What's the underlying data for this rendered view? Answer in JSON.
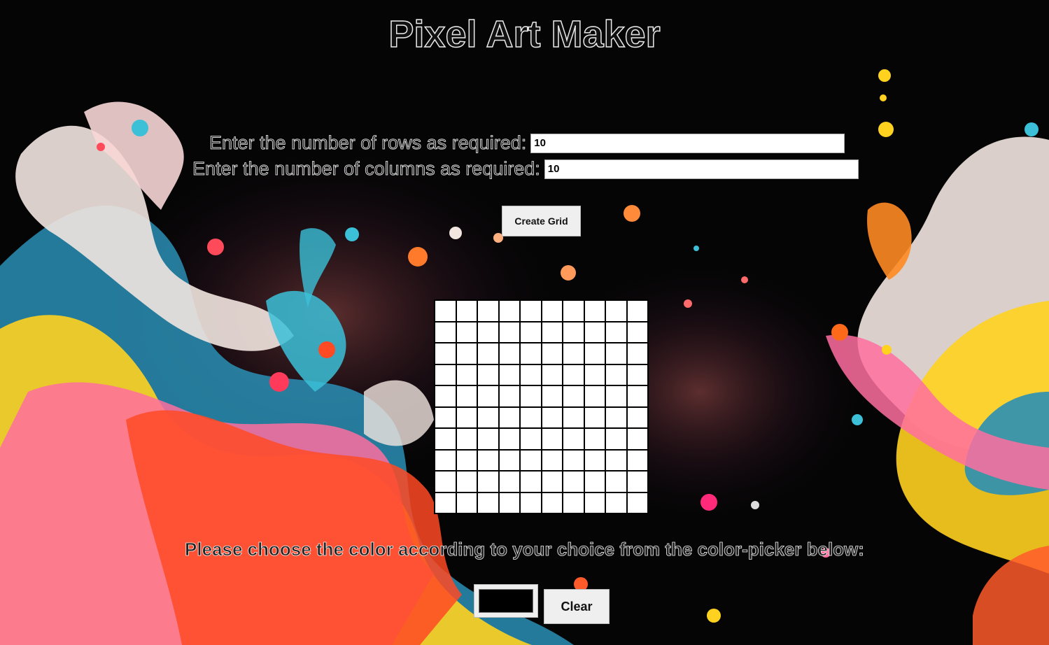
{
  "page": {
    "title": "Pixel Art Maker"
  },
  "form": {
    "rows_label": "Enter the number of rows as required:",
    "rows_value": "10",
    "columns_label": "Enter the number of columns as required:",
    "columns_value": "10",
    "create_button_label": "Create Grid"
  },
  "grid": {
    "rows": 10,
    "columns": 10,
    "cell_color": "#ffffff",
    "border_color": "#000000"
  },
  "color_section": {
    "label": "Please choose the color according to your choice from the color-picker below:",
    "selected_color": "#000000",
    "clear_button_label": "Clear"
  },
  "background": {
    "description_icon": "paint-splash-background",
    "colors": [
      "#ff6fa0",
      "#ffd21f",
      "#2bb6d6",
      "#ff5a2a",
      "#f4ede8"
    ]
  }
}
